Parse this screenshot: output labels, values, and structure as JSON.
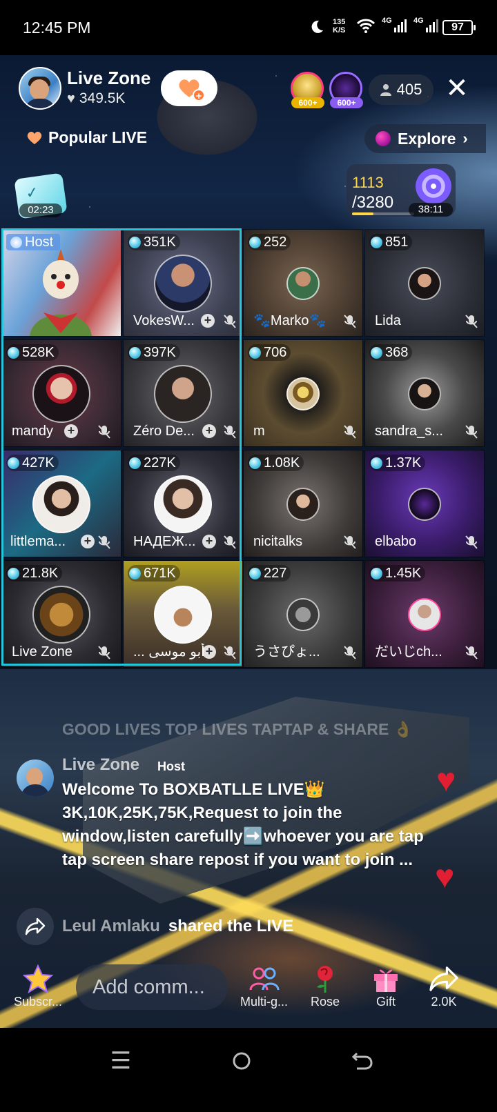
{
  "status_bar": {
    "time": "12:45 PM",
    "net_speed_value": "135",
    "net_speed_unit": "K/S",
    "network1": "4G",
    "network2": "4G",
    "battery": "97"
  },
  "header": {
    "host_name": "Live Zone",
    "host_likes": "349.5K",
    "top_viewers": [
      {
        "badge": "600+"
      },
      {
        "badge": "600+"
      }
    ],
    "viewer_count": "405"
  },
  "subheader": {
    "popular_label": "Popular LIVE",
    "explore_label": "Explore",
    "chip_timer": "02:23",
    "goal_current": "1113",
    "goal_total": "/3280",
    "goal_progress": 0.34,
    "goal_timer": "38:11"
  },
  "grid": {
    "host_label": "Host",
    "tiles": [
      {
        "score": "351K",
        "name": "VokesW..."
      },
      {
        "score": "252",
        "name": "🐾Marko🐾"
      },
      {
        "score": "851",
        "name": "Lida"
      },
      {
        "score": "528K",
        "name": "mandy"
      },
      {
        "score": "397K",
        "name": "Zéro De..."
      },
      {
        "score": "706",
        "name": "m"
      },
      {
        "score": "368",
        "name": "sandra_s..."
      },
      {
        "score": "427K",
        "name": "littlema..."
      },
      {
        "score": "227K",
        "name": "НАДЕЖ..."
      },
      {
        "score": "1.08K",
        "name": "nicitalks"
      },
      {
        "score": "1.37K",
        "name": "elbabo"
      },
      {
        "score": "21.8K",
        "name": "Live Zone"
      },
      {
        "score": "671K",
        "name": "... أبو موسى"
      },
      {
        "score": "227",
        "name": "うさぴょ..."
      },
      {
        "score": "1.45K",
        "name": "だいじch..."
      }
    ]
  },
  "chat": {
    "faded_line": "GOOD LIVES  TOP LIVES  TAPTAP & SHARE 👌",
    "host_user": "Live Zone",
    "host_tag": "Host",
    "host_message": "Welcome To BOXBATLLE LIVE👑 3K,10K,25K,75K,Request to join the window,listen carefully➡️whoever you are tap tap screen share repost if you want to join ...",
    "share_user": "Leul Amlaku",
    "share_text": "shared the LIVE"
  },
  "bottom_bar": {
    "subscribe_label": "Subscr...",
    "comment_placeholder": "Add comm...",
    "multiguest_label": "Multi-g...",
    "rose_label": "Rose",
    "gift_label": "Gift",
    "share_count": "2.0K"
  },
  "icons": {
    "accent_cyan": "#27c5da",
    "heart_red": "#e21e32",
    "goal_yellow": "#ffd84a"
  }
}
